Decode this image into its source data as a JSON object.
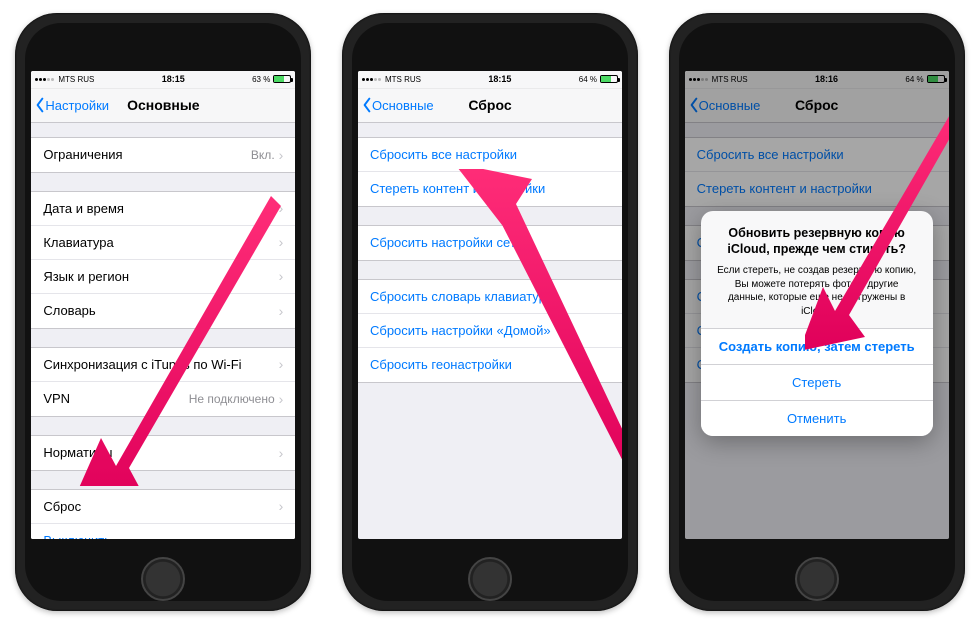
{
  "phone1": {
    "status": {
      "carrier": "MTS RUS",
      "signal_icon": "wifi-icon",
      "time": "18:15",
      "battery_pct": "63 %"
    },
    "nav": {
      "back": "Настройки",
      "title": "Основные"
    },
    "groups": [
      [
        {
          "label": "Ограничения",
          "value": "Вкл.",
          "chev": true
        }
      ],
      [
        {
          "label": "Дата и время",
          "chev": true
        },
        {
          "label": "Клавиатура",
          "chev": true
        },
        {
          "label": "Язык и регион",
          "chev": true
        },
        {
          "label": "Словарь",
          "chev": true
        }
      ],
      [
        {
          "label": "Синхронизация с iTunes по Wi-Fi",
          "chev": true
        },
        {
          "label": "VPN",
          "value": "Не подключено",
          "chev": true
        }
      ],
      [
        {
          "label": "Нормативы",
          "chev": true
        }
      ],
      [
        {
          "label": "Сброс",
          "chev": true
        },
        {
          "label": "Выключить",
          "link": true
        }
      ]
    ]
  },
  "phone2": {
    "status": {
      "carrier": "MTS RUS",
      "time": "18:15",
      "battery_pct": "64 %"
    },
    "nav": {
      "back": "Основные",
      "title": "Сброс"
    },
    "groups": [
      [
        {
          "label": "Сбросить все настройки",
          "link": true
        },
        {
          "label": "Стереть контент и настройки",
          "link": true
        }
      ],
      [
        {
          "label": "Сбросить настройки сети",
          "link": true
        }
      ],
      [
        {
          "label": "Сбросить словарь клавиатуры",
          "link": true
        },
        {
          "label": "Сбросить настройки «Домой»",
          "link": true
        },
        {
          "label": "Сбросить геонастройки",
          "link": true
        }
      ]
    ]
  },
  "phone3": {
    "status": {
      "carrier": "MTS RUS",
      "time": "18:16",
      "battery_pct": "64 %"
    },
    "nav": {
      "back": "Основные",
      "title": "Сброс"
    },
    "groups": [
      [
        {
          "label": "Сбросить все настройки",
          "link": true
        },
        {
          "label": "Стереть контент и настройки",
          "link": true
        }
      ],
      [
        {
          "label": "Сбросить настройки сети",
          "link": true
        }
      ],
      [
        {
          "label": "Сбросить словарь клавиатуры",
          "link": true
        },
        {
          "label": "Сбросить настройки «Домой»",
          "link": true
        },
        {
          "label": "Сбросить геонастройки",
          "link": true
        }
      ]
    ],
    "alert": {
      "title": "Обновить резервную копию iCloud, прежде чем стирать?",
      "message": "Если стереть, не создав резервную копию, Вы можете потерять фото и другие данные, которые еще не выгружены в iCloud.",
      "primary": "Создать копию, затем стереть",
      "secondary": "Стереть",
      "cancel": "Отменить"
    }
  }
}
